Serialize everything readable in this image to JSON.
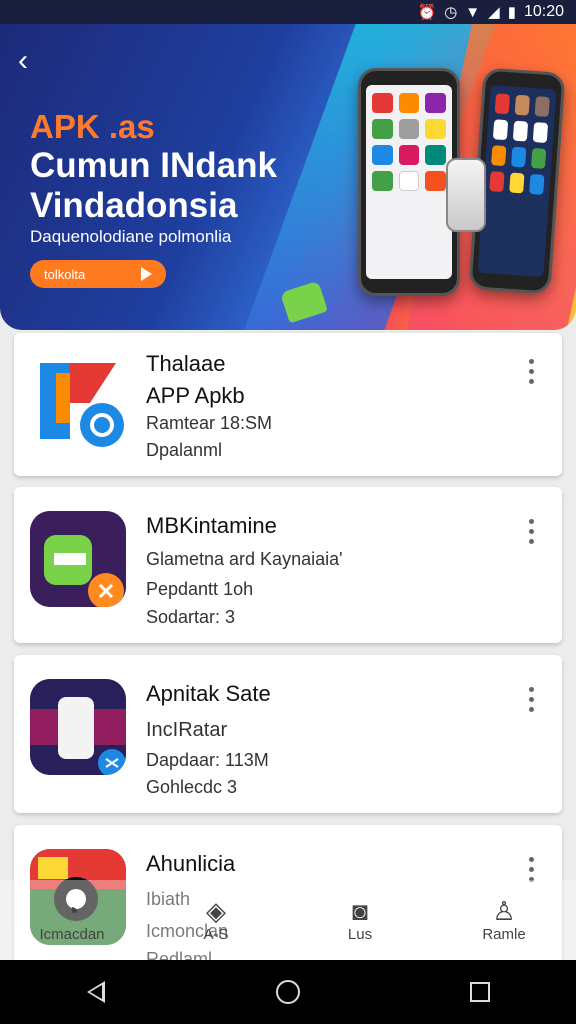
{
  "status_bar": {
    "time": "10:20",
    "icons": [
      "alarm-icon",
      "clock-icon",
      "wifi-icon",
      "signal-icon",
      "battery-icon"
    ]
  },
  "banner": {
    "tag": "APK .as",
    "title": "Cumun INdank Vindadonsia",
    "subtitle": "Daquenolodiane polmonlia",
    "cta_label": "tolkolta",
    "colors": {
      "orange": "#ff7a1f",
      "blue": "#1f3f9f"
    }
  },
  "apps": [
    {
      "name": "Thalaae",
      "line1": "APP Apkb",
      "line2": "Ramtear 18:SM",
      "line3": "Dpalanml"
    },
    {
      "name": "MBKintamine",
      "line1": "Glametna ard Kaynaiaia'",
      "line2": "Pepdantt 1oh",
      "line3": "Sodartar: 3"
    },
    {
      "name": "Apnitak Sate",
      "line1": "IncIRatar",
      "line2": "Dapdaar: 113M",
      "line3": "Gohlecdc 3"
    },
    {
      "name": "Ahunlicia",
      "line1": "Ibiath",
      "line2": "Icmonclan",
      "line3": "Redlaml"
    }
  ],
  "bottom_nav": [
    {
      "icon": "timer-icon",
      "label": "Icmacdan"
    },
    {
      "icon": "compass-icon",
      "label": "A-S"
    },
    {
      "icon": "camera-icon",
      "label": "Lus"
    },
    {
      "icon": "person-icon",
      "label": "Ramle"
    }
  ]
}
